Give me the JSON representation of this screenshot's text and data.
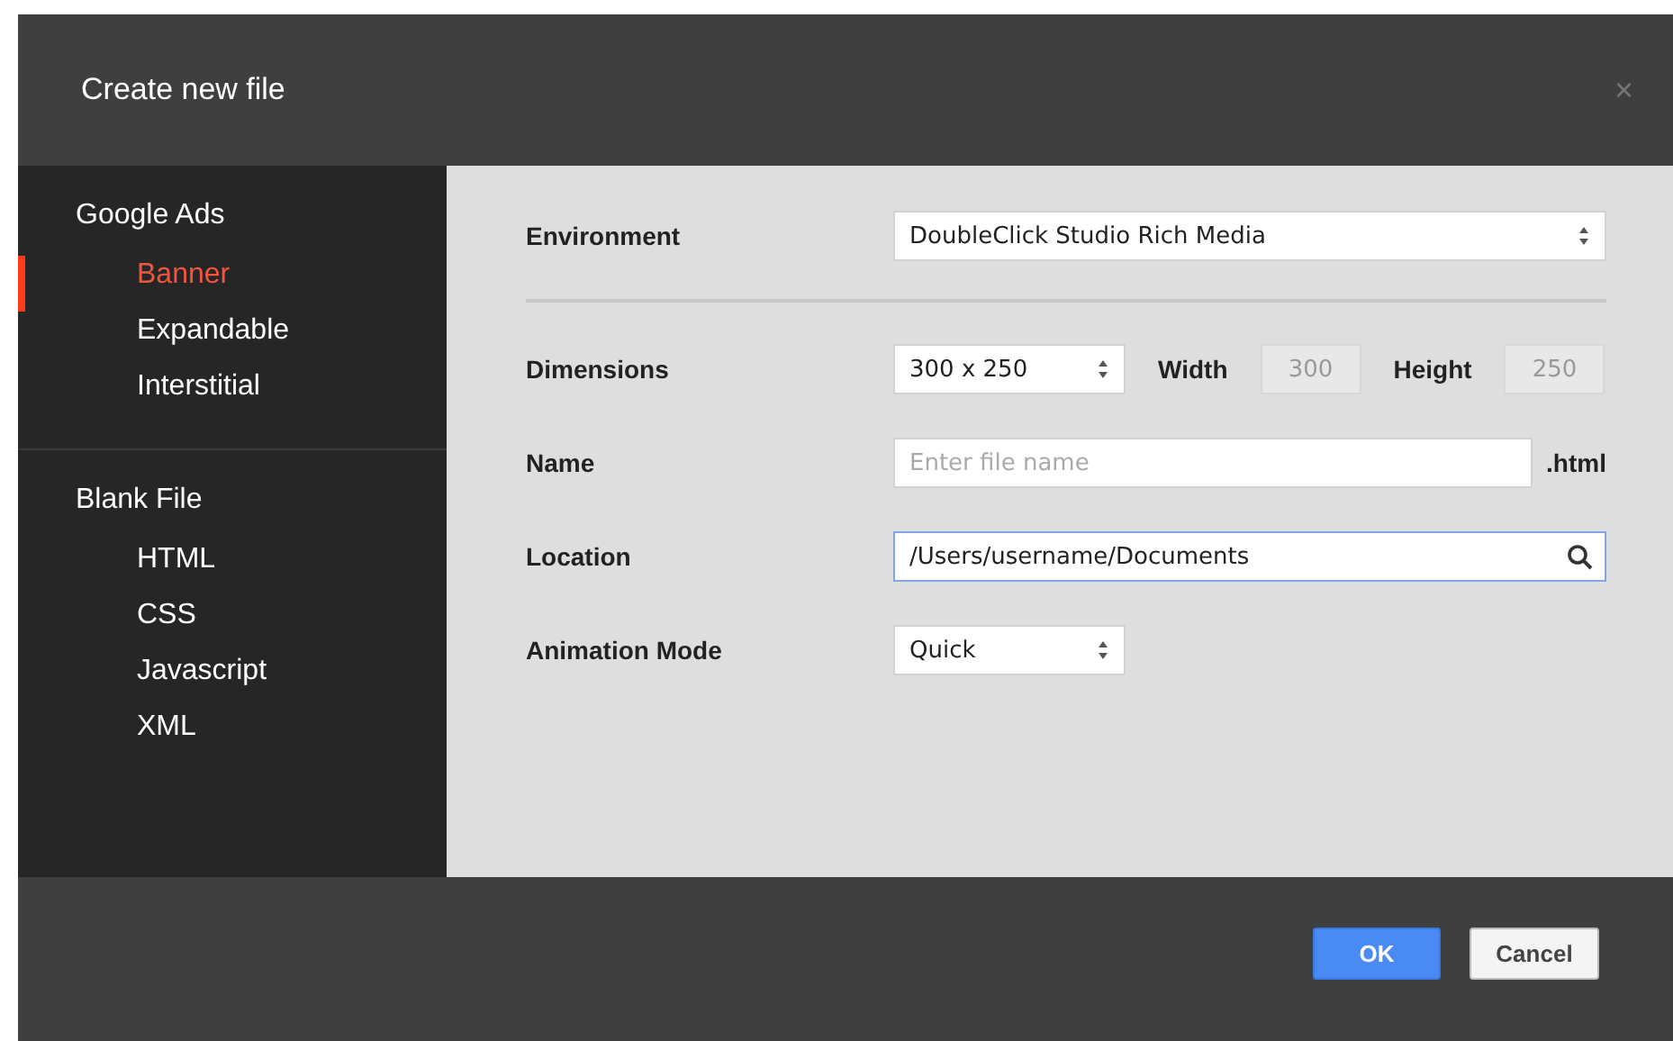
{
  "dialog": {
    "title": "Create new file",
    "close": "×"
  },
  "sidebar": [
    {
      "label": "Google Ads",
      "items": [
        {
          "label": "Banner",
          "selected": true
        },
        {
          "label": "Expandable",
          "selected": false
        },
        {
          "label": "Interstitial",
          "selected": false
        }
      ]
    },
    {
      "label": "Blank File",
      "items": [
        {
          "label": "HTML",
          "selected": false
        },
        {
          "label": "CSS",
          "selected": false
        },
        {
          "label": "Javascript",
          "selected": false
        },
        {
          "label": "XML",
          "selected": false
        }
      ]
    }
  ],
  "form": {
    "environment": {
      "label": "Environment",
      "value": "DoubleClick Studio Rich Media"
    },
    "dimensions": {
      "label": "Dimensions",
      "value": "300 x 250",
      "width_label": "Width",
      "width_value": "300",
      "height_label": "Height",
      "height_value": "250"
    },
    "name": {
      "label": "Name",
      "placeholder": "Enter file name",
      "suffix": ".html"
    },
    "location": {
      "label": "Location",
      "value": "/Users/username/Documents",
      "focused": true
    },
    "animation": {
      "label": "Animation Mode",
      "value": "Quick"
    }
  },
  "buttons": [
    {
      "label": "OK",
      "kind": "primary"
    },
    {
      "label": "Cancel",
      "kind": "secondary"
    }
  ]
}
